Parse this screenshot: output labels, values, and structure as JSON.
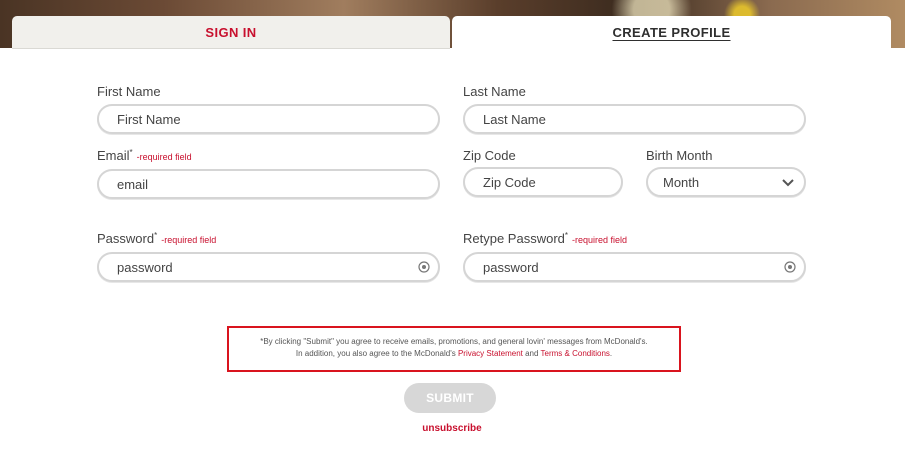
{
  "tabs": {
    "sign_in": "SIGN IN",
    "create_profile": "CREATE PROFILE"
  },
  "form": {
    "first_name": {
      "label": "First Name",
      "placeholder": "First Name"
    },
    "last_name": {
      "label": "Last Name",
      "placeholder": "Last Name"
    },
    "email": {
      "label": "Email",
      "marker": "*",
      "required": "-required field",
      "placeholder": "email"
    },
    "zip": {
      "label": "Zip Code",
      "placeholder": "Zip Code"
    },
    "birth_month": {
      "label": "Birth Month",
      "selected": "Month"
    },
    "password": {
      "label": "Password",
      "marker": "*",
      "required": "-required field",
      "placeholder": "password"
    },
    "retype_password": {
      "label": "Retype Password",
      "marker": "*",
      "required": "-required field",
      "placeholder": "password"
    }
  },
  "notice": {
    "line1": "*By clicking \"Submit\" you agree to receive emails, promotions, and general lovin' messages from McDonald's.",
    "line2_prefix": "In addition, you also agree to the McDonald's ",
    "privacy_link": "Privacy Statement",
    "and": " and ",
    "terms_link": "Terms & Conditions",
    "end": "."
  },
  "actions": {
    "submit": "SUBMIT",
    "unsubscribe": "unsubscribe"
  },
  "colors": {
    "brand_red": "#c8102e",
    "notice_border": "#d9141e",
    "submit_disabled": "#d7d7d7"
  },
  "icons": {
    "password_toggle": "eye-icon",
    "dropdown": "chevron-down-icon"
  }
}
